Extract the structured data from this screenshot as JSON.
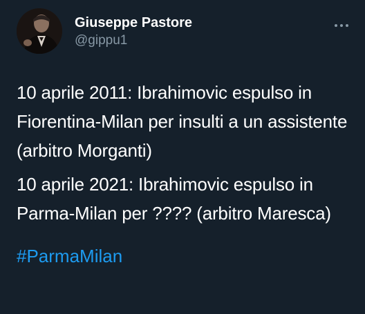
{
  "user": {
    "display_name": "Giuseppe Pastore",
    "handle": "@gippu1"
  },
  "icons": {
    "avatar": "profile-photo",
    "more": "more-dots-icon"
  },
  "tweet": {
    "paragraphs": [
      "10 aprile 2011: Ibrahimovic espulso in Fiorentina-Milan per insulti a un assistente (arbitro Morganti)",
      "10 aprile 2021: Ibrahimovic espulso in Parma-Milan per ???? (arbitro Maresca)"
    ],
    "hashtag": "#ParmaMilan"
  },
  "colors": {
    "background": "#15202b",
    "text": "#ffffff",
    "secondary": "#8899a6",
    "link": "#1d9bf0"
  }
}
